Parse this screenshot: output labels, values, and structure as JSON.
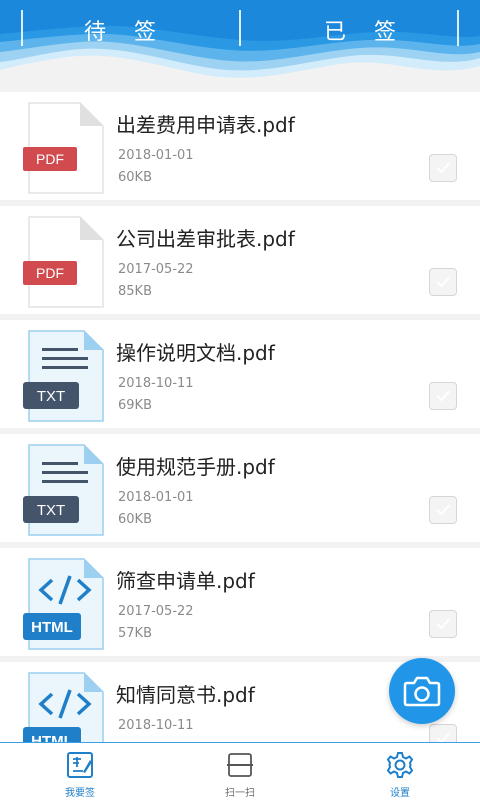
{
  "tabs": [
    {
      "label": "待签",
      "active": true
    },
    {
      "label": "已签",
      "active": false
    }
  ],
  "files": [
    {
      "name": "出差费用申请表.pdf",
      "date": "2018-01-01",
      "size": "60KB",
      "type_badge": "PDF",
      "icon": "pdf-file-icon",
      "checked": false
    },
    {
      "name": "公司出差审批表.pdf",
      "date": "2017-05-22",
      "size": "85KB",
      "type_badge": "PDF",
      "icon": "pdf-file-icon",
      "checked": false
    },
    {
      "name": "操作说明文档.pdf",
      "date": "2018-10-11",
      "size": "69KB",
      "type_badge": "TXT",
      "icon": "txt-file-icon",
      "checked": false
    },
    {
      "name": "使用规范手册.pdf",
      "date": "2018-01-01",
      "size": "60KB",
      "type_badge": "TXT",
      "icon": "txt-file-icon",
      "checked": false
    },
    {
      "name": "筛查申请单.pdf",
      "date": "2017-05-22",
      "size": "57KB",
      "type_badge": "HTML",
      "icon": "html-file-icon",
      "checked": false
    },
    {
      "name": "知情同意书.pdf",
      "date": "2018-10-11",
      "size": "",
      "type_badge": "HTML",
      "icon": "html-file-icon",
      "checked": false
    }
  ],
  "fab": {
    "icon": "camera-icon"
  },
  "bottom_nav": [
    {
      "label": "我要签",
      "icon": "sign-icon",
      "active": true
    },
    {
      "label": "扫一扫",
      "icon": "scan-icon",
      "active": false
    },
    {
      "label": "设置",
      "icon": "gear-icon",
      "active": false
    }
  ],
  "colors": {
    "primary": "#2196e8",
    "header_light": "#d3ecfb",
    "pdf_badge": "#d04a4e",
    "txt_badge": "#44546a",
    "html_badge": "#1f7fc9",
    "nav_active": "#1f7fc9"
  }
}
